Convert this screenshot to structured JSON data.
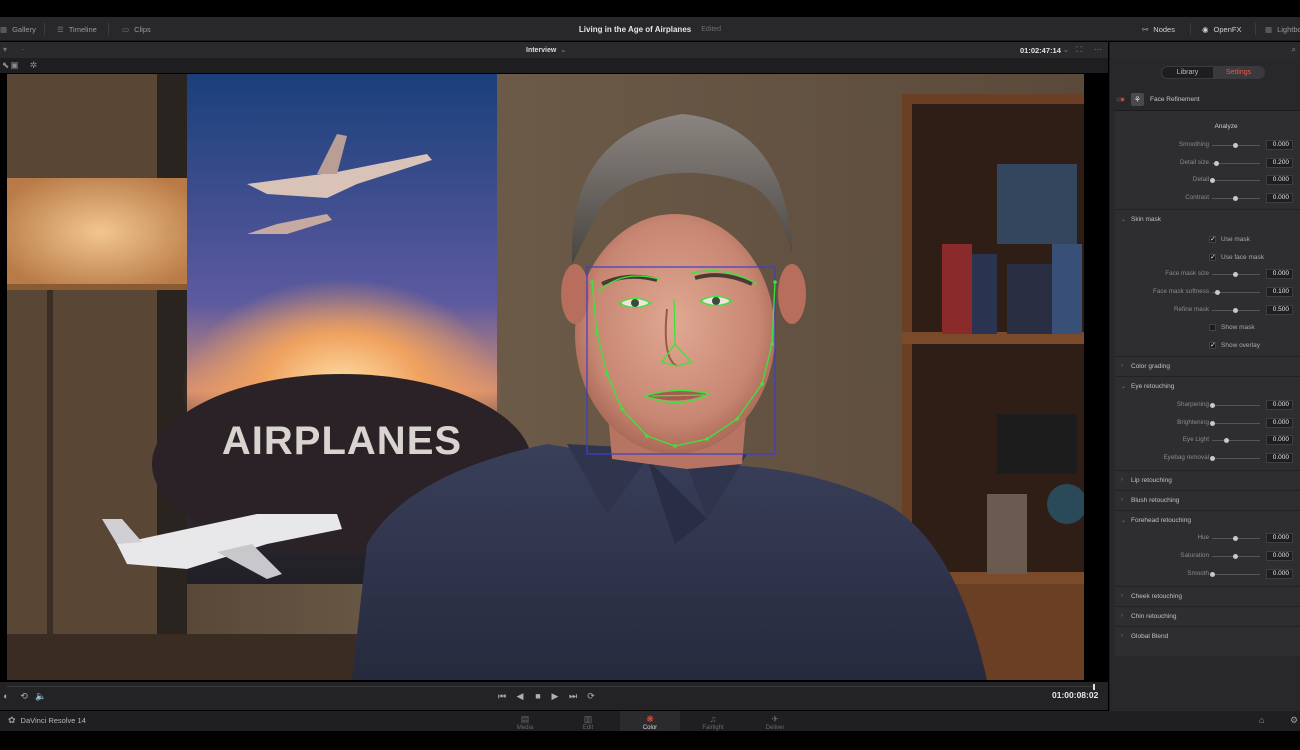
{
  "app": {
    "name": "DaVinci Resolve 14",
    "project_title": "Living in the Age of Airplanes",
    "project_status": "Edited"
  },
  "top_tabs": [
    {
      "label": "Gallery",
      "icon": "gallery-icon"
    },
    {
      "label": "Timeline",
      "icon": "timeline-icon"
    },
    {
      "label": "Clips",
      "icon": "clips-icon"
    }
  ],
  "top_right": [
    {
      "label": "Nodes",
      "icon": "nodes-icon"
    },
    {
      "label": "OpenFX",
      "icon": "openfx-icon"
    },
    {
      "label": "Lightbo",
      "icon": "lightbox-icon"
    }
  ],
  "viewer": {
    "clip_name": "Interview",
    "timecode": "01:02:47:14",
    "poster_text": "AIRPLANES",
    "transport_timecode": "01:00:08:02"
  },
  "panel": {
    "tabs": [
      "Library",
      "Settings"
    ],
    "active_tab": "Settings",
    "effect_name": "Face Refinement",
    "analyze_label": "Analyze",
    "top_params": [
      {
        "label": "Smoothing",
        "value": "0.000",
        "pos": 0.5
      },
      {
        "label": "Detail size",
        "value": "0.200",
        "pos": 0.08
      },
      {
        "label": "Detail",
        "value": "0.000",
        "pos": 0.0
      },
      {
        "label": "Contrast",
        "value": "0.000",
        "pos": 0.5
      }
    ],
    "skin_mask": {
      "title": "Skin mask",
      "checks_top": [
        {
          "label": "Use mask",
          "checked": true
        },
        {
          "label": "Use face mask",
          "checked": true
        }
      ],
      "params": [
        {
          "label": "Face mask size",
          "value": "0.000",
          "pos": 0.5
        },
        {
          "label": "Face mask softness",
          "value": "0.100",
          "pos": 0.1
        },
        {
          "label": "Refine mask",
          "value": "0.500",
          "pos": 0.5
        }
      ],
      "checks_bottom": [
        {
          "label": "Show mask",
          "checked": false
        },
        {
          "label": "Show overlay",
          "checked": true
        }
      ]
    },
    "color_grading": "Color grading",
    "eye_retouching": {
      "title": "Eye retouching",
      "params": [
        {
          "label": "Sharpening",
          "value": "0.000",
          "pos": 0.0
        },
        {
          "label": "Brightening",
          "value": "0.000",
          "pos": 0.0
        },
        {
          "label": "Eye Light",
          "value": "0.000",
          "pos": 0.3
        },
        {
          "label": "Eyebag removal",
          "value": "0.000",
          "pos": 0.0
        }
      ]
    },
    "lip_retouching": "Lip retouching",
    "blush_retouching": "Blush retouching",
    "forehead_retouching": {
      "title": "Forehead retouching",
      "params": [
        {
          "label": "Hue",
          "value": "0.000",
          "pos": 0.5
        },
        {
          "label": "Saturation",
          "value": "0.000",
          "pos": 0.5
        },
        {
          "label": "Smooth",
          "value": "0.000",
          "pos": 0.0
        }
      ]
    },
    "cheek_retouching": "Cheek retouching",
    "chin_retouching": "Chin retouching",
    "global_blend": "Global Blend"
  },
  "pages": [
    {
      "label": "Media",
      "icon": "media-icon"
    },
    {
      "label": "Edit",
      "icon": "edit-icon"
    },
    {
      "label": "Color",
      "icon": "color-icon",
      "active": true
    },
    {
      "label": "Fairlight",
      "icon": "fairlight-icon"
    },
    {
      "label": "Deliver",
      "icon": "deliver-icon"
    }
  ],
  "colors": {
    "accent": "#e8563f",
    "tracking_mesh": "#3de33d",
    "tracking_box": "#3d3dd0"
  }
}
